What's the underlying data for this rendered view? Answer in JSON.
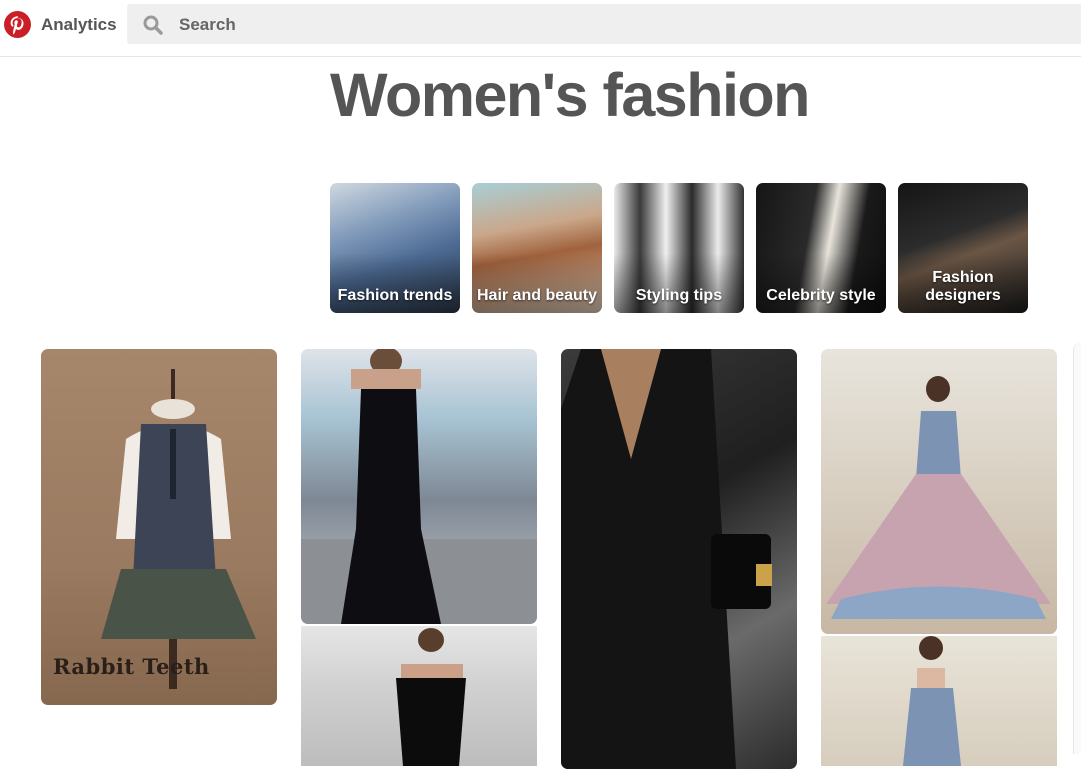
{
  "header": {
    "app_name": "Analytics",
    "search": {
      "placeholder": "Search",
      "value": ""
    },
    "icons": {
      "logo": "pinterest-logo-icon",
      "search": "search-icon"
    },
    "colors": {
      "brand": "#cb1f27",
      "search_bg": "#efefef"
    }
  },
  "page": {
    "title": "Women's fashion"
  },
  "topics": [
    {
      "label": "Fashion trends"
    },
    {
      "label": "Hair and beauty"
    },
    {
      "label": "Styling tips"
    },
    {
      "label": "Celebrity style"
    },
    {
      "label": "Fashion designers"
    }
  ],
  "pins": [
    {
      "subject": "lolita-vest-dress",
      "caption": "Rabbit Teeth"
    },
    {
      "subject": "black-off-shoulder-gown"
    },
    {
      "subject": "black-off-shoulder-jumpsuit"
    },
    {
      "subject": "black-blazer-handbag"
    },
    {
      "subject": "blue-pink-tulle-gown"
    },
    {
      "subject": "gown-back-view"
    }
  ]
}
